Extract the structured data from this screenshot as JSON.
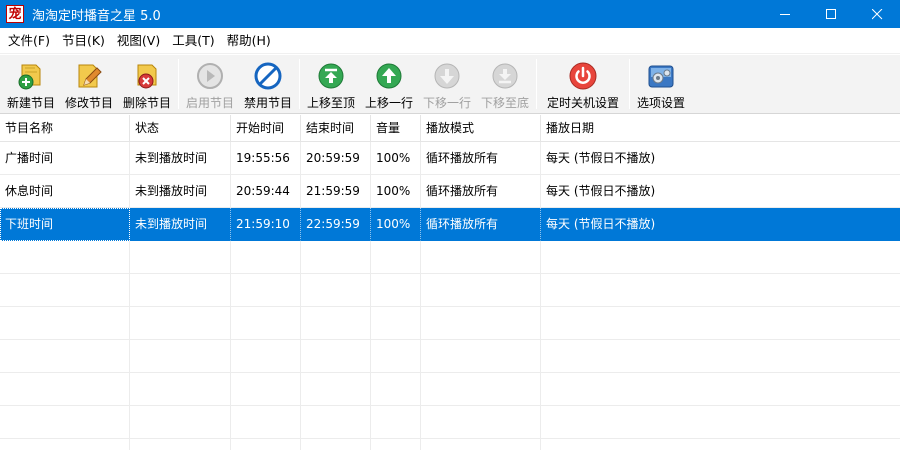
{
  "window": {
    "title": "淘淘定时播音之星 5.0",
    "icon_glyph": "宠"
  },
  "menu": [
    "文件(F)",
    "节目(K)",
    "视图(V)",
    "工具(T)",
    "帮助(H)"
  ],
  "toolbar": [
    {
      "label": "新建节目",
      "icon": "new-program-icon",
      "enabled": true
    },
    {
      "label": "修改节目",
      "icon": "edit-program-icon",
      "enabled": true
    },
    {
      "label": "删除节目",
      "icon": "delete-program-icon",
      "enabled": true
    },
    {
      "label": "启用节目",
      "icon": "enable-program-icon",
      "enabled": false
    },
    {
      "label": "禁用节目",
      "icon": "disable-program-icon",
      "enabled": true
    },
    {
      "label": "上移至顶",
      "icon": "move-top-icon",
      "enabled": true
    },
    {
      "label": "上移一行",
      "icon": "move-up-icon",
      "enabled": true
    },
    {
      "label": "下移一行",
      "icon": "move-down-icon",
      "enabled": false
    },
    {
      "label": "下移至底",
      "icon": "move-bottom-icon",
      "enabled": false
    },
    {
      "label": "定时关机设置",
      "icon": "shutdown-icon",
      "enabled": true
    },
    {
      "label": "选项设置",
      "icon": "options-icon",
      "enabled": true
    }
  ],
  "table": {
    "columns": [
      "节目名称",
      "状态",
      "开始时间",
      "结束时间",
      "音量",
      "播放模式",
      "播放日期"
    ],
    "rows": [
      [
        "广播时间",
        "未到播放时间",
        "19:55:56",
        "20:59:59",
        "100%",
        "循环播放所有",
        "每天 (节假日不播放)"
      ],
      [
        "休息时间",
        "未到播放时间",
        "20:59:44",
        "21:59:59",
        "100%",
        "循环播放所有",
        "每天 (节假日不播放)"
      ],
      [
        "下班时间",
        "未到播放时间",
        "21:59:10",
        "22:59:59",
        "100%",
        "循环播放所有",
        "每天 (节假日不播放)"
      ]
    ],
    "selected_row": 2
  },
  "colors": {
    "titlebar": "#0078d7",
    "selection": "#0078d7",
    "toolbar_bg": "#f3f3f3"
  }
}
